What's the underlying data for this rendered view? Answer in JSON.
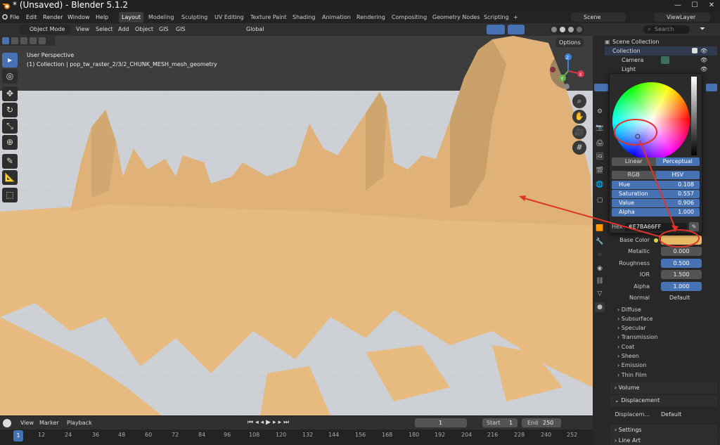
{
  "window": {
    "title": "* (Unsaved) - Blender 5.1.2",
    "minimize": "—",
    "maximize": "☐",
    "close": "✕"
  },
  "menu": {
    "items": [
      "File",
      "Edit",
      "Render",
      "Window",
      "Help"
    ]
  },
  "workspaces": [
    "Layout",
    "Modeling",
    "Sculpting",
    "UV Editing",
    "Texture Paint",
    "Shading",
    "Animation",
    "Rendering",
    "Compositing",
    "Geometry Nodes",
    "Scripting"
  ],
  "add_workspace": "+",
  "scene": {
    "label": "Scene",
    "view_layer": "ViewLayer"
  },
  "viewport_header": {
    "mode": "Object Mode",
    "menus": [
      "View",
      "Select",
      "Add",
      "Object",
      "GIS",
      "GIS"
    ],
    "transform": "Global",
    "options": "Options"
  },
  "viewport": {
    "perspective": "User Perspective",
    "collection_info": "(1) Collection | pop_tw_raster_2/3/2_CHUNK_MESH_mesh_geometry",
    "gizmo": {
      "x": "X",
      "y": "Y",
      "z": "Z"
    }
  },
  "timeline": {
    "menus": [
      "View",
      "Marker",
      "Playback"
    ],
    "current_frame": "1",
    "start_label": "Start",
    "start": "1",
    "end_label": "End",
    "end": "250",
    "frame_marker": "1",
    "ticks": [
      "12",
      "24",
      "36",
      "48",
      "60",
      "72",
      "84",
      "96",
      "108",
      "120",
      "132",
      "144",
      "156",
      "168",
      "180",
      "192",
      "204",
      "216",
      "228",
      "240",
      "252"
    ]
  },
  "outliner": {
    "search_placeholder": "Search",
    "scene_collection": "Scene Collection",
    "collection": "Collection",
    "items": [
      "Camera",
      "Light"
    ]
  },
  "color_picker": {
    "modes": [
      "Linear",
      "Perceptual"
    ],
    "active_mode": "Perceptual",
    "models": [
      "RGB",
      "HSV"
    ],
    "active_model": "HSV",
    "rows": [
      {
        "k": "Hue",
        "v": "0.108"
      },
      {
        "k": "Saturation",
        "v": "0.557"
      },
      {
        "k": "Value",
        "v": "0.906"
      },
      {
        "k": "Alpha",
        "v": "1.000"
      }
    ],
    "hex_label": "Hex",
    "hex": "#E7BA66FF"
  },
  "material": {
    "base_color_label": "Base Color",
    "base_color_hex": "#E7BA66",
    "props": [
      {
        "k": "Metallic",
        "v": "0.000",
        "blue": false
      },
      {
        "k": "Roughness",
        "v": "0.500",
        "blue": true
      },
      {
        "k": "IOR",
        "v": "1.500",
        "blue": false
      },
      {
        "k": "Alpha",
        "v": "1.000",
        "blue": true
      }
    ],
    "normal_label": "Normal",
    "normal_value": "Default",
    "subpanels": [
      "Diffuse",
      "Subsurface",
      "Specular",
      "Transmission",
      "Coat",
      "Sheen",
      "Emission",
      "Thin Film"
    ],
    "volume": "Volume",
    "displacement": "Displacement",
    "displacement_label": "Displacem...",
    "displacement_value": "Default",
    "settings": "Settings",
    "line_art": "Line Art"
  },
  "colors": {
    "accent": "#4772b3",
    "terrain": "#E7BA66",
    "annotation": "#e0342a"
  }
}
